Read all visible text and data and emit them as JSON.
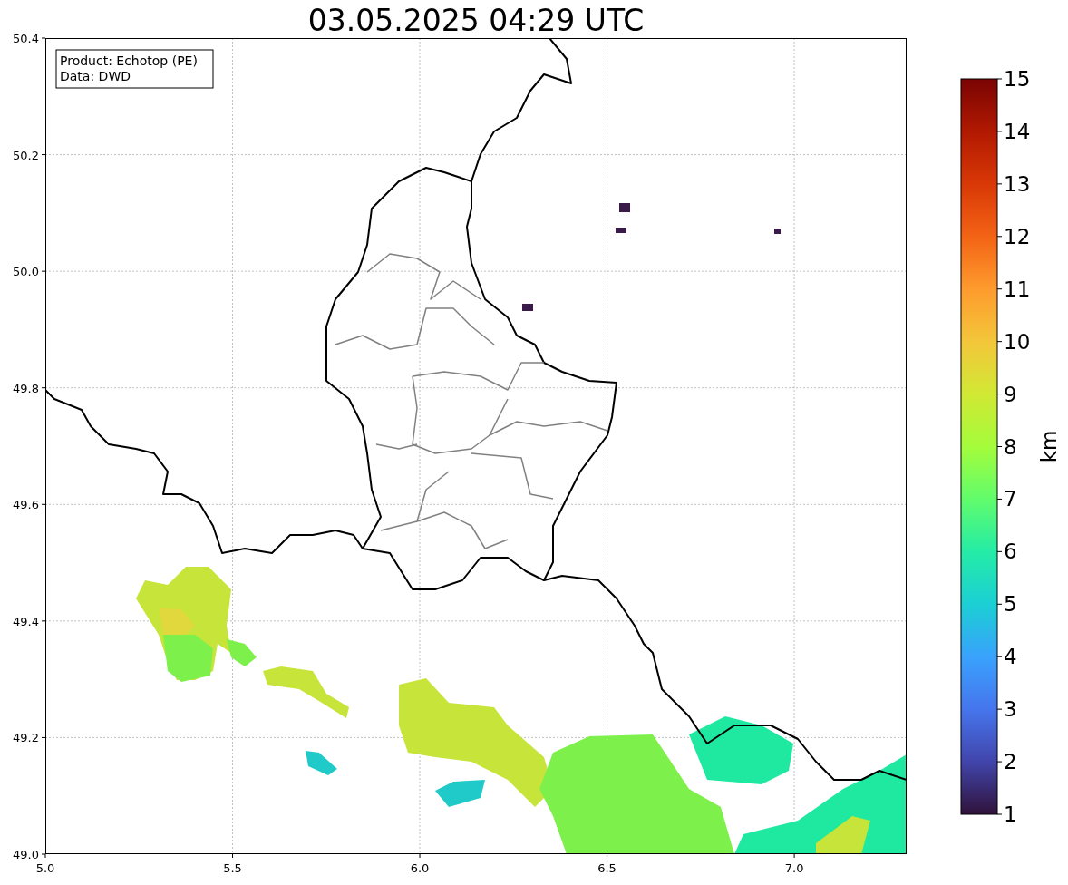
{
  "title": "03.05.2025 04:29 UTC",
  "info_box": [
    "Product: Echotop (PE)",
    "Data: DWD"
  ],
  "axes": {
    "xticks": [
      "5.0",
      "5.5",
      "6.0",
      "6.5",
      "7.0"
    ],
    "yticks": [
      "50.4",
      "50.2",
      "50.0",
      "49.8",
      "49.6",
      "49.4",
      "49.2",
      "49.0"
    ]
  },
  "colorbar": {
    "label": "km",
    "ticks": [
      "15",
      "14",
      "13",
      "12",
      "11",
      "10",
      "9",
      "8",
      "7",
      "6",
      "5",
      "4",
      "3",
      "2",
      "1"
    ]
  }
}
